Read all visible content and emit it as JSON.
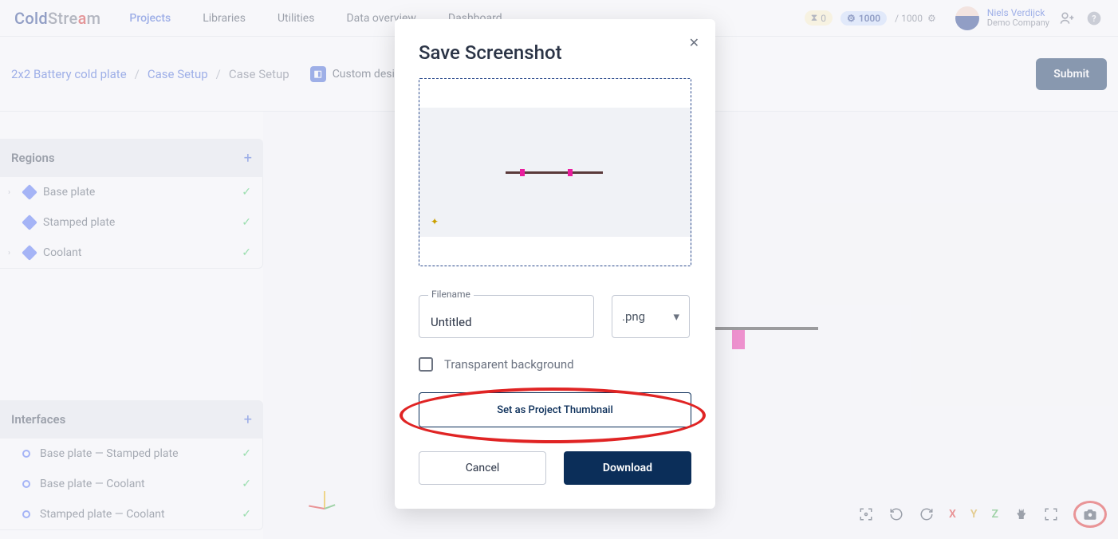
{
  "header": {
    "logo": "ColdStream",
    "nav": [
      "Projects",
      "Libraries",
      "Utilities",
      "Data overview",
      "Dashboard"
    ],
    "active_nav": 0,
    "queue_badge": "0",
    "credits_badge": "1000",
    "credits_total": "/ 1000",
    "user_name": "Niels Verdijck",
    "user_company": "Demo Company"
  },
  "breadcrumb": {
    "project": "2x2 Battery cold plate",
    "section": "Case Setup",
    "current": "Case Setup",
    "chip": "Custom design",
    "submit": "Submit"
  },
  "regions": {
    "title": "Regions",
    "items": [
      {
        "label": "Base plate",
        "expandable": true
      },
      {
        "label": "Stamped plate",
        "expandable": false
      },
      {
        "label": "Coolant",
        "expandable": true
      }
    ]
  },
  "interfaces": {
    "title": "Interfaces",
    "items": [
      {
        "label": "Base plate — Stamped plate"
      },
      {
        "label": "Base plate — Coolant"
      },
      {
        "label": "Stamped plate — Coolant"
      }
    ]
  },
  "view_toolbar": {
    "x": "X",
    "y": "Y",
    "z": "Z"
  },
  "modal": {
    "title": "Save Screenshot",
    "filename_label": "Filename",
    "filename_value": "Untitled",
    "extension": ".png",
    "transparent_label": "Transparent background",
    "thumbnail_btn": "Set as Project Thumbnail",
    "cancel": "Cancel",
    "download": "Download"
  }
}
